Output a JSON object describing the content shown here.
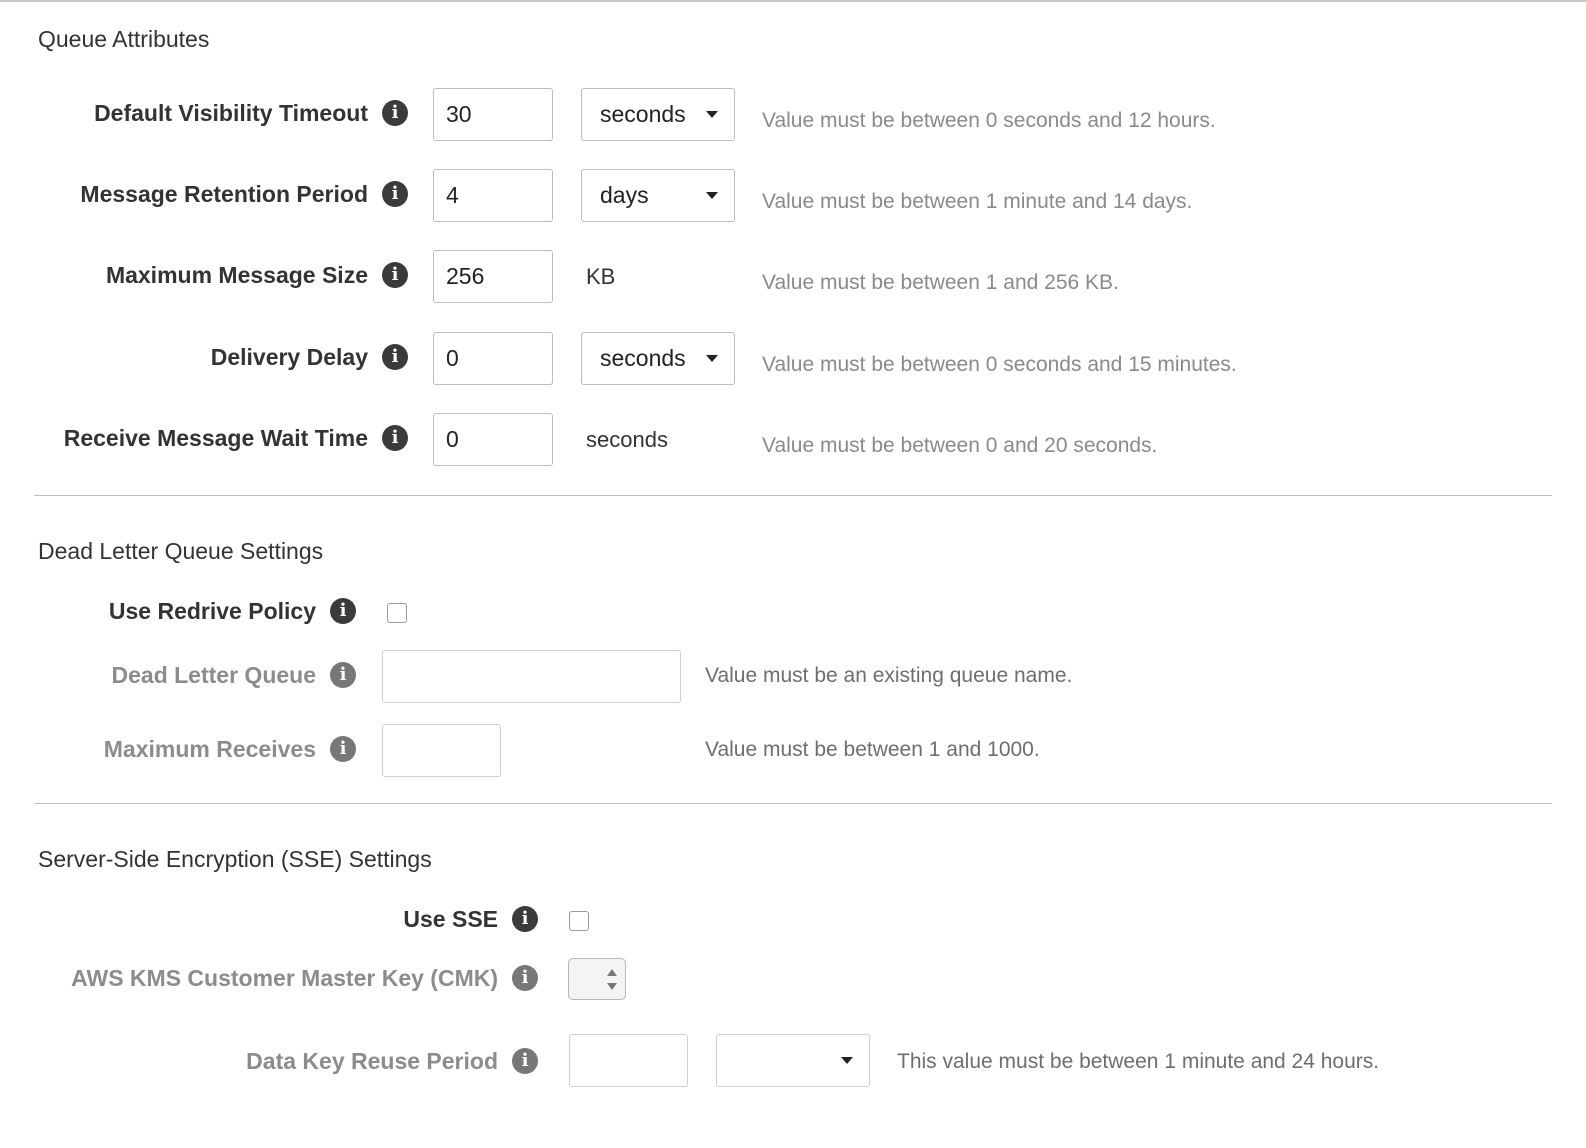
{
  "queue_attributes": {
    "title": "Queue Attributes",
    "rows": [
      {
        "label": "Default Visibility Timeout",
        "value": "30",
        "unit": "seconds",
        "unit_type": "select",
        "hint": "Value must be between 0 seconds and 12 hours."
      },
      {
        "label": "Message Retention Period",
        "value": "4",
        "unit": "days",
        "unit_type": "select",
        "hint": "Value must be between 1 minute and 14 days."
      },
      {
        "label": "Maximum Message Size",
        "value": "256",
        "unit": "KB",
        "unit_type": "text",
        "hint": "Value must be between 1 and 256 KB."
      },
      {
        "label": "Delivery Delay",
        "value": "0",
        "unit": "seconds",
        "unit_type": "select",
        "hint": "Value must be between 0 seconds and 15 minutes."
      },
      {
        "label": "Receive Message Wait Time",
        "value": "0",
        "unit": "seconds",
        "unit_type": "text",
        "hint": "Value must be between 0 and 20 seconds."
      }
    ]
  },
  "dead_letter": {
    "title": "Dead Letter Queue Settings",
    "use_redrive_label": "Use Redrive Policy",
    "use_redrive_checked": false,
    "dead_letter_queue_label": "Dead Letter Queue",
    "dead_letter_queue_value": "",
    "dead_letter_queue_hint": "Value must be an existing queue name.",
    "max_receives_label": "Maximum Receives",
    "max_receives_value": "",
    "max_receives_hint": "Value must be between 1 and 1000."
  },
  "sse": {
    "title": "Server-Side Encryption (SSE) Settings",
    "use_sse_label": "Use SSE",
    "use_sse_checked": false,
    "cmk_label": "AWS KMS Customer Master Key (CMK)",
    "reuse_label": "Data Key Reuse Period",
    "reuse_value": "",
    "reuse_unit": "",
    "reuse_hint": "This value must be between 1 minute and 24 hours."
  },
  "icons": {
    "info": "info-icon",
    "info_glyph": "i"
  }
}
